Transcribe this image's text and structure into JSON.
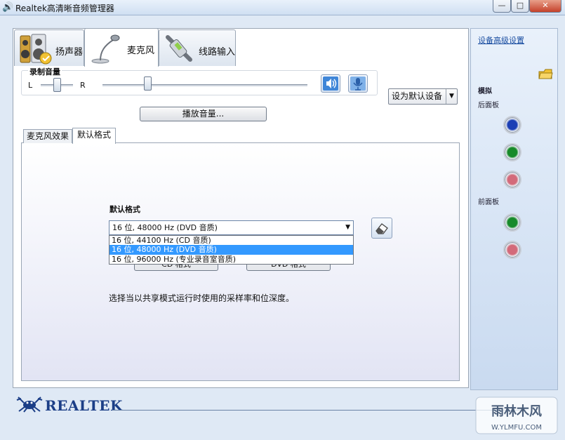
{
  "window": {
    "title": "Realtek高清晰音频管理器",
    "minimize": "—",
    "maximize": "□",
    "close": "✕"
  },
  "device_tabs": [
    {
      "label": "扬声器",
      "icon": "speaker-icon",
      "active": false
    },
    {
      "label": "麦克风",
      "icon": "microphone-icon",
      "active": true
    },
    {
      "label": "线路输入",
      "icon": "line-in-icon",
      "active": false
    }
  ],
  "record_volume": {
    "label": "录制音量",
    "balance_left": "L",
    "balance_right": "R",
    "balance_level": 0.5,
    "volume_level": 0.22
  },
  "set_default_device": "设为默认设备",
  "playback_volume_button": "播放音量...",
  "inner_tabs": [
    {
      "label": "麦克风效果",
      "active": false
    },
    {
      "label": "默认格式",
      "active": true
    }
  ],
  "default_format": {
    "title": "默认格式",
    "selected": "16 位, 48000 Hz (DVD 音质)",
    "options": [
      "16 位, 44100 Hz (CD 音质)",
      "16 位, 48000 Hz (DVD 音质)",
      "16 位, 96000 Hz (专业录音室音质)"
    ],
    "selected_index": 1,
    "cd_button": "CD 格式",
    "dvd_button": "DVD 格式",
    "description": "选择当以共享模式运行时使用的采样率和位深度。"
  },
  "right_panel": {
    "advanced_link": "设备高级设置",
    "analog": "模拟",
    "back_panel": "后面板",
    "front_panel": "前面板",
    "back_jacks": [
      "#1c3fb5",
      "#178a2a",
      "#d36a7a"
    ],
    "front_jacks": [
      "#178a2a",
      "#d36a7a"
    ]
  },
  "footer": {
    "brand": "REALTEK"
  },
  "watermark": {
    "text": "雨林木风",
    "url": "W.YLMFU.COM"
  }
}
